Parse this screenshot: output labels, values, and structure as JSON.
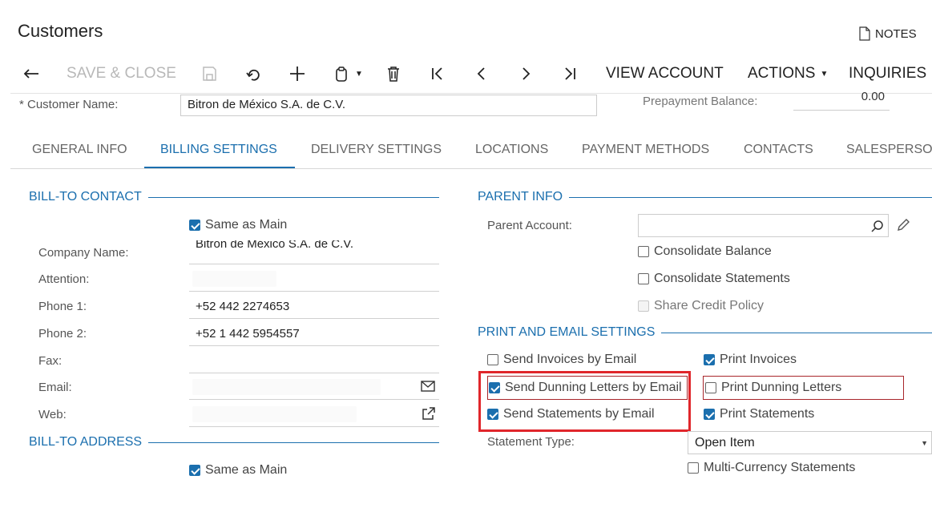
{
  "header": {
    "title": "Customers",
    "notes_label": "NOTES"
  },
  "toolbar": {
    "save_close": "SAVE & CLOSE",
    "view_account": "VIEW ACCOUNT",
    "actions": "ACTIONS",
    "inquiries": "INQUIRIES"
  },
  "form": {
    "customer_name_label": "* Customer Name:",
    "customer_name_value": "Bitron de México S.A. de C.V.",
    "prepayment_label": "Prepayment Balance:",
    "prepayment_value": "0.00"
  },
  "tabs": [
    "GENERAL INFO",
    "BILLING SETTINGS",
    "DELIVERY SETTINGS",
    "LOCATIONS",
    "PAYMENT METHODS",
    "CONTACTS",
    "SALESPERSO"
  ],
  "bill_to_contact": {
    "title": "BILL-TO CONTACT",
    "same_as_main": "Same as Main",
    "fields": [
      {
        "label": "Company Name:",
        "value": "Bitron de México S.A. de C.V."
      },
      {
        "label": "Attention:",
        "value": ""
      },
      {
        "label": "Phone 1:",
        "value": "+52 442 2274653"
      },
      {
        "label": "Phone 2:",
        "value": "+52 1 442 5954557"
      },
      {
        "label": "Fax:",
        "value": ""
      },
      {
        "label": "Email:",
        "value": ""
      },
      {
        "label": "Web:",
        "value": ""
      }
    ]
  },
  "bill_to_address": {
    "title": "BILL-TO ADDRESS",
    "same_as_main": "Same as Main"
  },
  "parent_info": {
    "title": "PARENT INFO",
    "parent_account_label": "Parent Account:",
    "consolidate_balance": "Consolidate Balance",
    "consolidate_statements": "Consolidate Statements",
    "share_credit_policy": "Share Credit Policy"
  },
  "print_email": {
    "title": "PRINT AND EMAIL SETTINGS",
    "send_invoices": "Send Invoices by Email",
    "send_dunning": "Send Dunning Letters by Email",
    "send_statements": "Send Statements by Email",
    "print_invoices": "Print Invoices",
    "print_dunning": "Print Dunning Letters",
    "print_statements": "Print Statements",
    "statement_type_label": "Statement Type:",
    "statement_type_value": "Open Item",
    "multi_currency": "Multi-Currency Statements"
  },
  "colors": {
    "accent": "#1b6fae",
    "highlight": "#e0262b"
  }
}
